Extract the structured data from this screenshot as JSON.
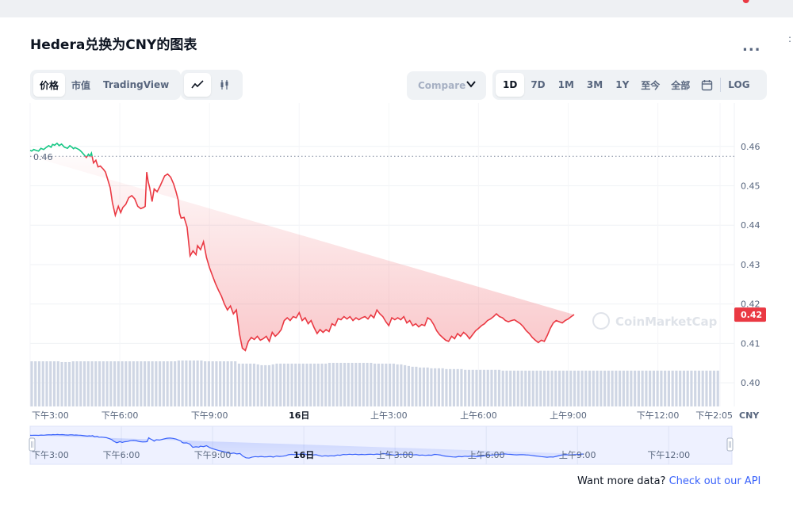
{
  "header": {
    "title": "Hedera兑换为CNY的图表",
    "more_label": "..."
  },
  "view_tabs": [
    {
      "label": "价格",
      "active": true
    },
    {
      "label": "市值",
      "active": false
    },
    {
      "label": "TradingView",
      "active": false
    }
  ],
  "chart_type_icons": [
    "line-chart-icon",
    "candlestick-icon"
  ],
  "compare": {
    "label": "Compare"
  },
  "range_tabs": [
    {
      "label": "1D",
      "active": true
    },
    {
      "label": "7D",
      "active": false
    },
    {
      "label": "1M",
      "active": false
    },
    {
      "label": "3M",
      "active": false
    },
    {
      "label": "1Y",
      "active": false
    },
    {
      "label": "至今",
      "active": false
    },
    {
      "label": "全部",
      "active": false
    }
  ],
  "log_label": "LOG",
  "footer": {
    "text": "Want more data?",
    "link": "Check out our API"
  },
  "colors": {
    "up": "#16c784",
    "down": "#ea3943",
    "navigator": "#3861fb",
    "volume": "#cfd6e4"
  },
  "chart_data": {
    "type": "area",
    "currency": "CNY",
    "open_price": 0.4575,
    "open_label": "0.46",
    "current_price": 0.4173,
    "current_label": "0.42",
    "ylim": [
      0.394,
      0.469
    ],
    "yticks": [
      0.4,
      0.41,
      0.42,
      0.43,
      0.44,
      0.45,
      0.46
    ],
    "ytick_labels": [
      "0.40",
      "0.41",
      "0.42",
      "0.43",
      "0.44",
      "0.45",
      "0.46"
    ],
    "x_hours": [
      0,
      0.05,
      0.12,
      0.2,
      0.28,
      0.36,
      0.45,
      0.55,
      0.62,
      0.7,
      0.75,
      0.82,
      0.9,
      0.97,
      1.05,
      1.15,
      1.25,
      1.33,
      1.4,
      1.45,
      1.5,
      1.58,
      1.65,
      1.72,
      1.8,
      1.88,
      1.95,
      2.0,
      2.05,
      2.12,
      2.2,
      2.27,
      2.35,
      2.45,
      2.52,
      2.6,
      2.68,
      2.75,
      2.85,
      2.95,
      3.03,
      3.1,
      3.2,
      3.3,
      3.4,
      3.5,
      3.6,
      3.7,
      3.8,
      3.85,
      3.9,
      3.95,
      4.0,
      4.08,
      4.15,
      4.25,
      4.35,
      4.5,
      4.6,
      4.7,
      4.8,
      4.88,
      4.95,
      5.0,
      5.05,
      5.15,
      5.25,
      5.35,
      5.45,
      5.55,
      5.6,
      5.7,
      5.8,
      5.9,
      6.0,
      6.1,
      6.2,
      6.3,
      6.4,
      6.5,
      6.6,
      6.7,
      6.8,
      6.9,
      7.0,
      7.1,
      7.2,
      7.3,
      7.4,
      7.5,
      7.6,
      7.7,
      7.8,
      7.9,
      8.0,
      8.1,
      8.2,
      8.3,
      8.4,
      8.5,
      8.6,
      8.7,
      8.8,
      8.9,
      9.0,
      9.1,
      9.2,
      9.3,
      9.4,
      9.5,
      9.6,
      9.7,
      9.8,
      9.9,
      10.0,
      10.1,
      10.2,
      10.3,
      10.4,
      10.5,
      10.6,
      10.7,
      10.8,
      10.9,
      11.0,
      11.1,
      11.2,
      11.3,
      11.4,
      11.5,
      11.6,
      11.7,
      11.8,
      11.9,
      12.0,
      12.1,
      12.2,
      12.3,
      12.4,
      12.5,
      12.6,
      12.7,
      12.8,
      12.9,
      13.0,
      13.1,
      13.2,
      13.3,
      13.4,
      13.5,
      13.6,
      13.7,
      13.8,
      13.9,
      14.0,
      14.1,
      14.2,
      14.3,
      14.4,
      14.5,
      14.6,
      14.7,
      14.8,
      14.9,
      15.0,
      15.1,
      15.2,
      15.3,
      15.4,
      15.5,
      15.6,
      15.7,
      15.8,
      15.9,
      16.0,
      16.1,
      16.2,
      16.3,
      16.4,
      16.5,
      16.6,
      16.7,
      16.8,
      16.9,
      17.0,
      17.1,
      17.2,
      17.3,
      17.4,
      17.5,
      17.6,
      17.7,
      17.8,
      17.9,
      18.0,
      18.1,
      18.2,
      18.3,
      18.4,
      18.5,
      18.6,
      18.7,
      18.8,
      18.9,
      19.0,
      19.1,
      19.2,
      19.3,
      19.4,
      19.5,
      19.6,
      19.7,
      19.8,
      19.9,
      20.0,
      20.1,
      20.2,
      20.3,
      20.4,
      20.5,
      20.6,
      20.7,
      20.8,
      20.9,
      21.0,
      21.1,
      21.2,
      21.3,
      21.4,
      21.5,
      21.6,
      21.7,
      21.8,
      21.9,
      22.0,
      22.1,
      22.2,
      22.3,
      22.4,
      22.5,
      22.6,
      22.7,
      22.8,
      22.9,
      23.0,
      23.1,
      23.2,
      23.3,
      23.4,
      23.5,
      23.6,
      23.7,
      23.8,
      23.9,
      24.0
    ],
    "prices": [
      0.459,
      0.4588,
      0.4592,
      0.459,
      0.4588,
      0.4595,
      0.4592,
      0.4598,
      0.4602,
      0.4598,
      0.4605,
      0.4603,
      0.4608,
      0.4602,
      0.4606,
      0.4598,
      0.4595,
      0.4602,
      0.4598,
      0.4594,
      0.4597,
      0.4594,
      0.4591,
      0.4586,
      0.4579,
      0.4572,
      0.458,
      0.4575,
      0.4583,
      0.4558,
      0.4565,
      0.4548,
      0.455,
      0.4542,
      0.4535,
      0.4515,
      0.4495,
      0.4458,
      0.4425,
      0.4448,
      0.4432,
      0.4445,
      0.4453,
      0.447,
      0.4475,
      0.4467,
      0.4448,
      0.4442,
      0.4445,
      0.4448,
      0.4535,
      0.451,
      0.4495,
      0.446,
      0.4492,
      0.4485,
      0.45,
      0.4525,
      0.453,
      0.4522,
      0.4505,
      0.4485,
      0.4465,
      0.443,
      0.4418,
      0.442,
      0.4395,
      0.4322,
      0.4335,
      0.4325,
      0.4348,
      0.4338,
      0.4358,
      0.4318,
      0.4292,
      0.4272,
      0.4252,
      0.4235,
      0.422,
      0.42,
      0.4185,
      0.4195,
      0.4175,
      0.4185,
      0.4125,
      0.4088,
      0.4082,
      0.4105,
      0.4115,
      0.411,
      0.4118,
      0.4108,
      0.4112,
      0.4118,
      0.4105,
      0.4128,
      0.4118,
      0.4125,
      0.4135,
      0.4158,
      0.4165,
      0.4158,
      0.4168,
      0.4165,
      0.4178,
      0.4158,
      0.4165,
      0.415,
      0.4158,
      0.414,
      0.4125,
      0.4135,
      0.4128,
      0.4135,
      0.413,
      0.415,
      0.4145,
      0.4163,
      0.416,
      0.4168,
      0.4162,
      0.4168,
      0.4158,
      0.4165,
      0.416,
      0.4165,
      0.4168,
      0.4162,
      0.4172,
      0.4165,
      0.4185,
      0.4175,
      0.4168,
      0.4155,
      0.4145,
      0.4165,
      0.416,
      0.4165,
      0.416,
      0.4168,
      0.4152,
      0.4158,
      0.4145,
      0.415,
      0.4142,
      0.4148,
      0.4145,
      0.4165,
      0.416,
      0.4148,
      0.4132,
      0.4122,
      0.4115,
      0.4108,
      0.4105,
      0.4118,
      0.4112,
      0.4125,
      0.4118,
      0.4128,
      0.4122,
      0.4112,
      0.4122,
      0.4132,
      0.4138,
      0.4145,
      0.415,
      0.4158,
      0.4162,
      0.4168,
      0.4175,
      0.4168,
      0.4165,
      0.4158,
      0.4155,
      0.4158,
      0.416,
      0.4155,
      0.415,
      0.4142,
      0.4132,
      0.4125,
      0.4115,
      0.4108,
      0.4102,
      0.4108,
      0.4105,
      0.412,
      0.4138,
      0.4152,
      0.4158,
      0.4155,
      0.4152,
      0.4158,
      0.4162,
      0.4168,
      0.4173
    ],
    "volume": [
      0.58,
      0.58,
      0.58,
      0.58,
      0.58,
      0.58,
      0.58,
      0.58,
      0.57,
      0.57,
      0.57,
      0.58,
      0.58,
      0.58,
      0.58,
      0.58,
      0.58,
      0.58,
      0.58,
      0.58,
      0.58,
      0.58,
      0.58,
      0.58,
      0.58,
      0.58,
      0.58,
      0.58,
      0.58,
      0.58,
      0.58,
      0.58,
      0.58,
      0.58,
      0.58,
      0.58,
      0.58,
      0.58,
      0.58,
      0.59,
      0.59,
      0.59,
      0.59,
      0.59,
      0.59,
      0.59,
      0.58,
      0.58,
      0.58,
      0.58,
      0.58,
      0.58,
      0.58,
      0.58,
      0.58,
      0.55,
      0.55,
      0.55,
      0.55,
      0.55,
      0.54,
      0.53,
      0.53,
      0.53,
      0.54,
      0.55,
      0.55,
      0.55,
      0.55,
      0.55,
      0.55,
      0.55,
      0.55,
      0.55,
      0.55,
      0.55,
      0.55,
      0.55,
      0.55,
      0.56,
      0.56,
      0.56,
      0.56,
      0.56,
      0.56,
      0.56,
      0.56,
      0.56,
      0.56,
      0.56,
      0.56,
      0.55,
      0.55,
      0.55,
      0.55,
      0.55,
      0.55,
      0.54,
      0.54,
      0.53,
      0.52,
      0.51,
      0.51,
      0.5,
      0.5,
      0.5,
      0.49,
      0.49,
      0.49,
      0.49,
      0.48,
      0.48,
      0.48,
      0.48,
      0.48,
      0.47,
      0.47,
      0.47,
      0.47,
      0.47,
      0.47,
      0.47,
      0.47,
      0.47,
      0.47,
      0.46,
      0.46,
      0.46,
      0.46,
      0.46,
      0.46,
      0.46,
      0.46,
      0.46,
      0.46,
      0.46,
      0.46,
      0.46,
      0.46,
      0.46,
      0.46,
      0.46,
      0.46,
      0.46,
      0.46,
      0.46,
      0.46,
      0.46,
      0.46,
      0.46,
      0.46,
      0.46,
      0.46,
      0.46,
      0.46,
      0.46,
      0.46,
      0.46,
      0.46,
      0.46,
      0.46,
      0.46,
      0.46,
      0.46,
      0.46,
      0.46,
      0.46,
      0.46,
      0.46,
      0.46,
      0.46,
      0.46,
      0.46,
      0.46,
      0.46,
      0.46,
      0.46,
      0.46,
      0.46,
      0.46,
      0.46,
      0.46,
      0.46
    ],
    "xticks": [
      {
        "hour": 0,
        "label": "下午3:00",
        "bold": false
      },
      {
        "hour": 3,
        "label": "下午6:00",
        "bold": false
      },
      {
        "hour": 6,
        "label": "下午9:00",
        "bold": false
      },
      {
        "hour": 9,
        "label": "16日",
        "bold": true
      },
      {
        "hour": 12,
        "label": "上午3:00",
        "bold": false
      },
      {
        "hour": 15,
        "label": "上午6:00",
        "bold": false
      },
      {
        "hour": 18,
        "label": "上午9:00",
        "bold": false
      },
      {
        "hour": 21,
        "label": "下午12:00",
        "bold": false
      },
      {
        "hour": 23.08,
        "label": "下午2:05",
        "bold": false
      }
    ],
    "nav_ticks": [
      {
        "hour": 0,
        "label": "下午3:00",
        "bold": false
      },
      {
        "hour": 3,
        "label": "下午6:00",
        "bold": false
      },
      {
        "hour": 6,
        "label": "下午9:00",
        "bold": false
      },
      {
        "hour": 9,
        "label": "16日",
        "bold": true
      },
      {
        "hour": 12,
        "label": "上午3:00",
        "bold": false
      },
      {
        "hour": 15,
        "label": "上午6:00",
        "bold": false
      },
      {
        "hour": 18,
        "label": "上午9:00",
        "bold": false
      },
      {
        "hour": 21,
        "label": "下午12:00",
        "bold": false
      }
    ],
    "watermark": "CoinMarketCap",
    "grid": true
  }
}
